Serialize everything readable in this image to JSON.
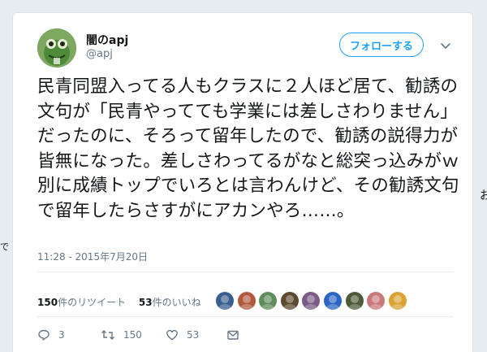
{
  "user": {
    "display_name": "闇のapj",
    "handle": "@apj"
  },
  "follow_button": {
    "label": "フォローする"
  },
  "tweet": {
    "text": "民青同盟入ってる人もクラスに２人ほど居て、勧誘の文句が「民青やってても学業には差しさわりません」だったのに、そろって留年したので、勧誘の説得力が皆無になった。差しさわってるがなと総突っ込みがｗ別に成績トップでいろとは言わんけど、その勧誘文句で留年したらさすがにアカンやろ……。",
    "timestamp": "11:28 - 2015年7月20日"
  },
  "stats": {
    "retweet_count": "150",
    "retweet_label": "件のリツイート",
    "like_count": "53",
    "like_label": "件のいいね"
  },
  "likers": [
    {
      "icon": "liker-avatar",
      "color": "#3a5f8f"
    },
    {
      "icon": "liker-avatar",
      "color": "#b05a3c"
    },
    {
      "icon": "liker-avatar",
      "color": "#5e8c5a"
    },
    {
      "icon": "liker-avatar",
      "color": "#5c4a2e"
    },
    {
      "icon": "liker-avatar",
      "color": "#7a5b86"
    },
    {
      "icon": "liker-avatar",
      "color": "#2b66c4"
    },
    {
      "icon": "liker-avatar",
      "color": "#4f5a3a"
    },
    {
      "icon": "liker-avatar",
      "color": "#c9787a"
    },
    {
      "icon": "liker-avatar",
      "color": "#d9a233"
    }
  ],
  "actions": {
    "reply_count": "3",
    "retweet_count": "150",
    "like_count": "53"
  },
  "colors": {
    "accent": "#1da1f2",
    "text": "#14171a",
    "muted": "#657786",
    "divider": "#e6ecf0"
  },
  "background": {
    "left_edge_char": "で",
    "right_edge_char": "お"
  }
}
